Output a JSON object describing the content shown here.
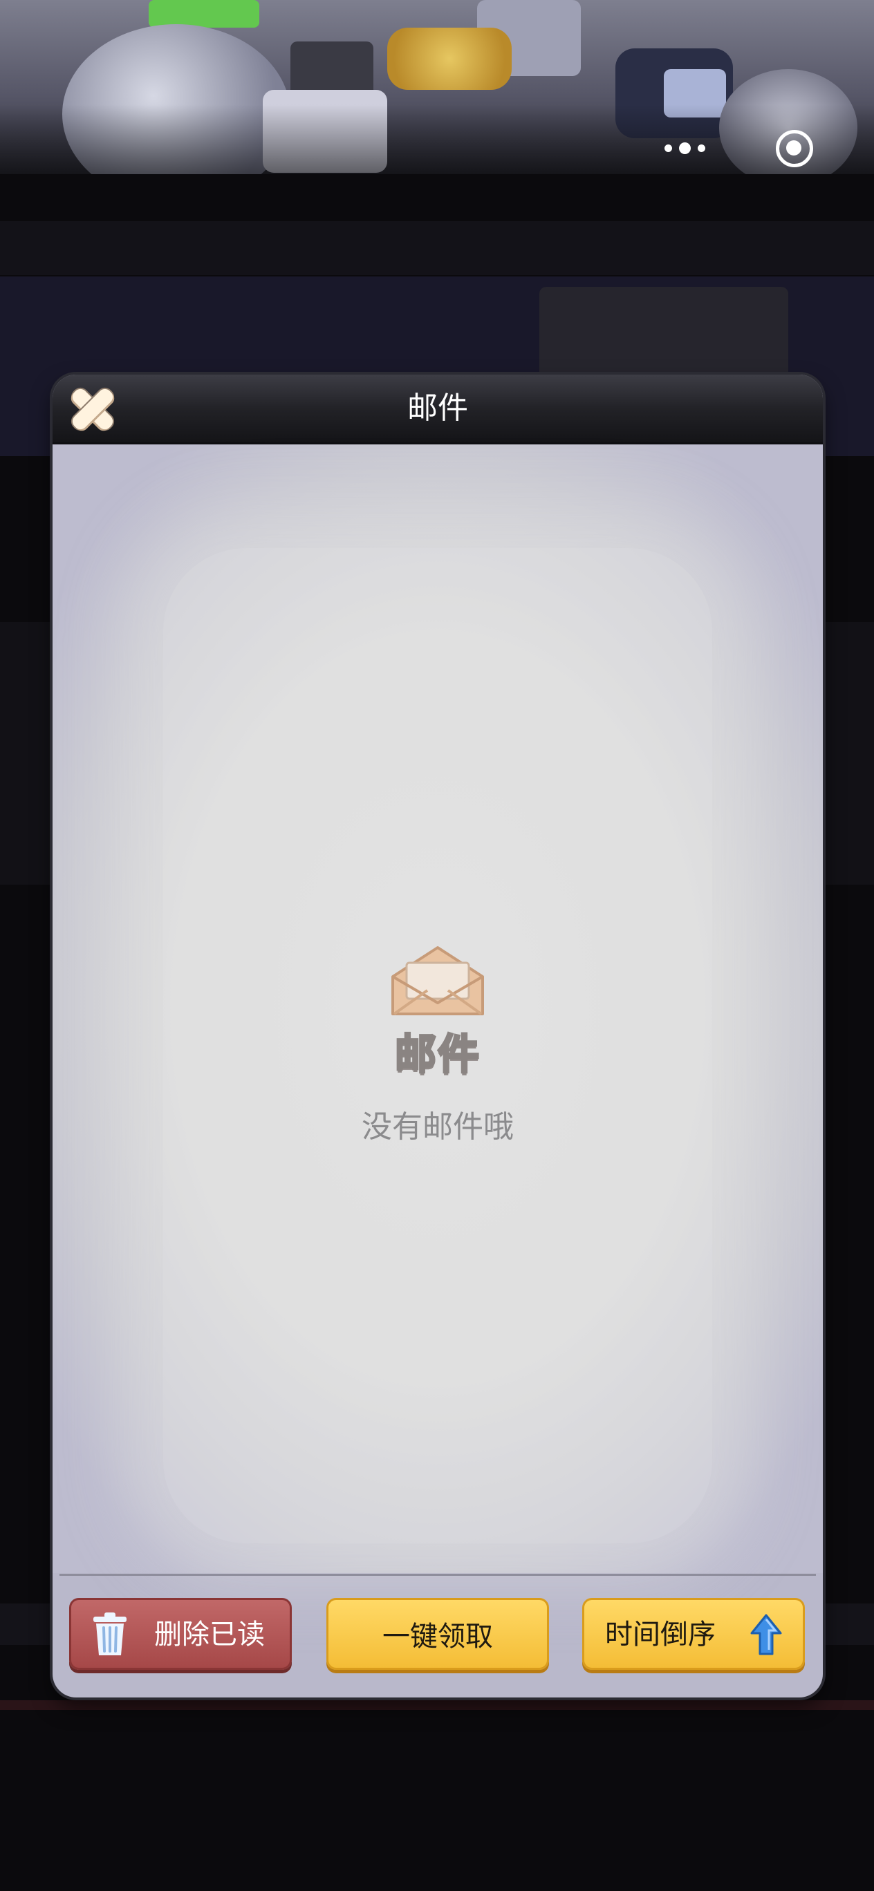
{
  "panel": {
    "title": "邮件",
    "empty_logo": "邮件",
    "empty_message": "没有邮件哦"
  },
  "actions": {
    "delete_read": "删除已读",
    "claim_all": "一键领取",
    "sort_time": "时间倒序"
  },
  "icons": {
    "close": "close-icon",
    "more": "more-dots-icon",
    "exit": "target-exit-icon",
    "envelope": "envelope-icon",
    "trash": "trash-icon",
    "sort_arrow": "arrow-up-icon"
  },
  "colors": {
    "delete_button": "#b05252",
    "yellow_button": "#f6c63e",
    "header": "#222227",
    "panel_body": "#dadada"
  }
}
